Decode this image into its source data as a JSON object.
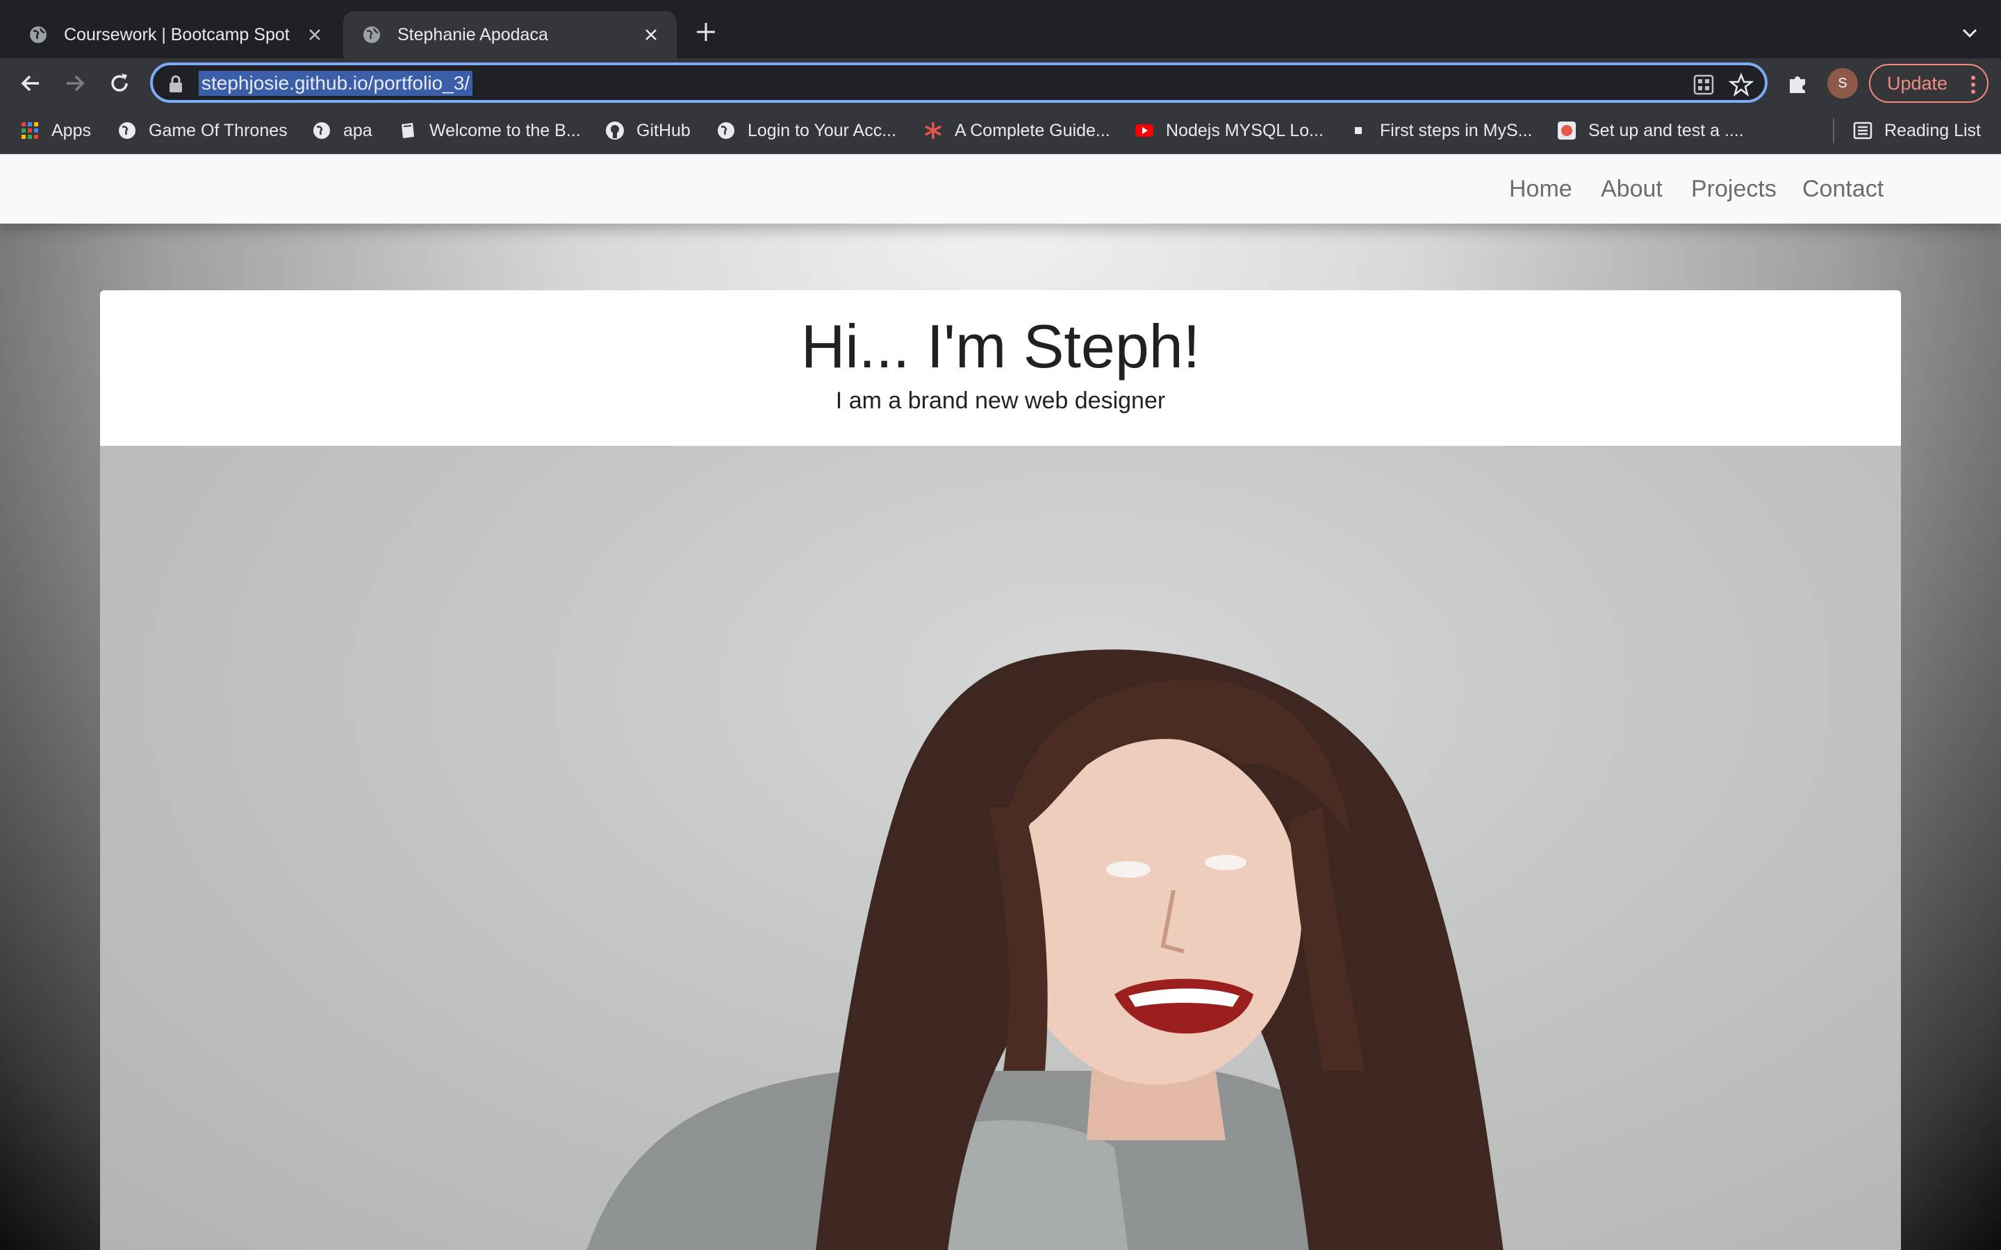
{
  "browser": {
    "tabs": [
      {
        "title": "Coursework | Bootcamp Spot",
        "active": false
      },
      {
        "title": "Stephanie Apodaca",
        "active": true
      }
    ],
    "url": "stephjosie.github.io/portfolio_3/",
    "profile_initial": "S",
    "update_label": "Update",
    "bookmarks": [
      {
        "label": "Apps",
        "icon": "apps-grid-icon"
      },
      {
        "label": "Game Of Thrones",
        "icon": "globe-icon"
      },
      {
        "label": "apa",
        "icon": "globe-icon"
      },
      {
        "label": "Welcome to the B...",
        "icon": "book-icon"
      },
      {
        "label": "GitHub",
        "icon": "github-icon"
      },
      {
        "label": "Login to Your Acc...",
        "icon": "globe-icon"
      },
      {
        "label": "A Complete Guide...",
        "icon": "asterisk-icon"
      },
      {
        "label": "Nodejs MYSQL Lo...",
        "icon": "youtube-icon"
      },
      {
        "label": "First steps in MyS...",
        "icon": "square-icon"
      },
      {
        "label": "Set up and test a ....",
        "icon": "badge-icon"
      }
    ],
    "reading_list": "Reading List"
  },
  "site": {
    "nav": [
      "Home",
      "About",
      "Projects",
      "Contact"
    ],
    "hero_title": "Hi... I'm Steph!",
    "hero_subtitle": "I am a brand new web designer"
  },
  "colors": {
    "chrome_dark": "#202124",
    "chrome_toolbar": "#35363a",
    "focus_ring": "#7cacf8",
    "update_accent": "#f28b82",
    "nav_bg": "#f8f9fa"
  }
}
